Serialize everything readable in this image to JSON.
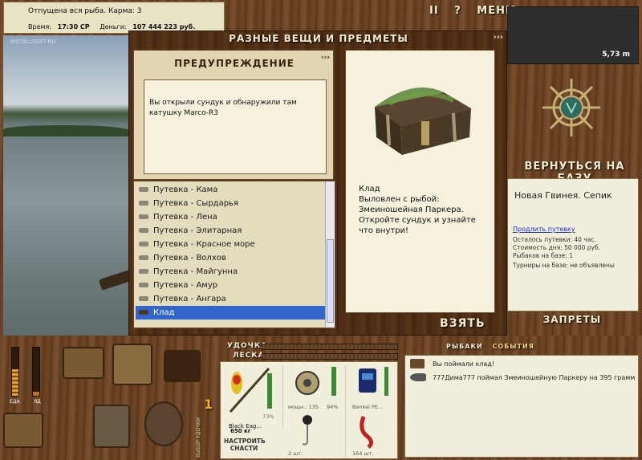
{
  "status": {
    "message": "Отпущена вся рыба. Карма: 3",
    "time_label": "Время:",
    "time_value": "17:30 СР",
    "money_label": "Деньги:",
    "money_value": "107 444 223 руб."
  },
  "top_controls": {
    "pause": "II",
    "help": "?",
    "menu": "МЕНЮ"
  },
  "map": {
    "depth": "5,73 m"
  },
  "scene": {
    "watermark": "INSTALLSOFT.RU"
  },
  "dialog": {
    "title": "РАЗНЫЕ ВЕЩИ И ПРЕДМЕТЫ",
    "chevrons": "›››",
    "warning": {
      "title": "ПРЕДУПРЕЖДЕНИЕ",
      "chevrons": "›››",
      "text": "Вы открыли сундук и обнаружили там катушку Marco-R3"
    },
    "items": [
      {
        "label": "Путевка - Кама",
        "selected": false
      },
      {
        "label": "Путевка - Сырдарья",
        "selected": false
      },
      {
        "label": "Путевка - Лена",
        "selected": false
      },
      {
        "label": "Путевка - Элитарная",
        "selected": false
      },
      {
        "label": "Путевка - Красное море",
        "selected": false
      },
      {
        "label": "Путевка - Волхов",
        "selected": false
      },
      {
        "label": "Путевка - Майгунна",
        "selected": false
      },
      {
        "label": "Путевка - Амур",
        "selected": false
      },
      {
        "label": "Путевка - Ангара",
        "selected": false
      },
      {
        "label": "Клад",
        "selected": true
      }
    ],
    "preview": {
      "description": "Клад\nВыловлен с рыбой: Змеиношейная Паркера. Откройте сундук и узнайте что внутри!"
    },
    "take_button": "ВЗЯТЬ"
  },
  "sidebar": {
    "return_button": "ВЕРНУТЬСЯ НА БАЗУ",
    "location": "Новая Гвинея. Сепик",
    "extend_link": "Продлить путевку",
    "info": [
      "Осталось путевки: 40 час.",
      "Стоимость дня: 50 000 руб.",
      "Рыбаков на базе: 1",
      "Турниры на базе: не объявлены"
    ],
    "bans_button": "ЗАПРЕТЫ"
  },
  "bottom": {
    "food_label": "ЕДА",
    "poison_label": "ЯД",
    "counter": "1",
    "counter_caption": "ВЫБОР УДОЧКИ",
    "rod_label": "УДОЧКА",
    "line_label": "ЛЕСКА",
    "tabs": [
      "РЫБАКИ",
      "СОБЫТИЯ"
    ],
    "tackle": {
      "rod_name": "Black Eag...",
      "rod_weight": "650 кг",
      "rod_percent": "73%",
      "reel_label": "мощн.: 135",
      "reel_percent": "94%",
      "line_name": "Benkei PE...",
      "hooks_count": "2 шт.",
      "bait_count": "164 шт.",
      "setup_button": "НАСТРОИТЬ СНАСТИ"
    },
    "log": [
      "Вы поймали клад!",
      "777Дима777 поймал Змеиношейную Паркеру на 395 грамм"
    ]
  },
  "meters": {
    "food_level": 0.55,
    "poison_level": 0.08
  },
  "colors": {
    "selection": "#3366cc",
    "link": "#1a2ec8"
  }
}
